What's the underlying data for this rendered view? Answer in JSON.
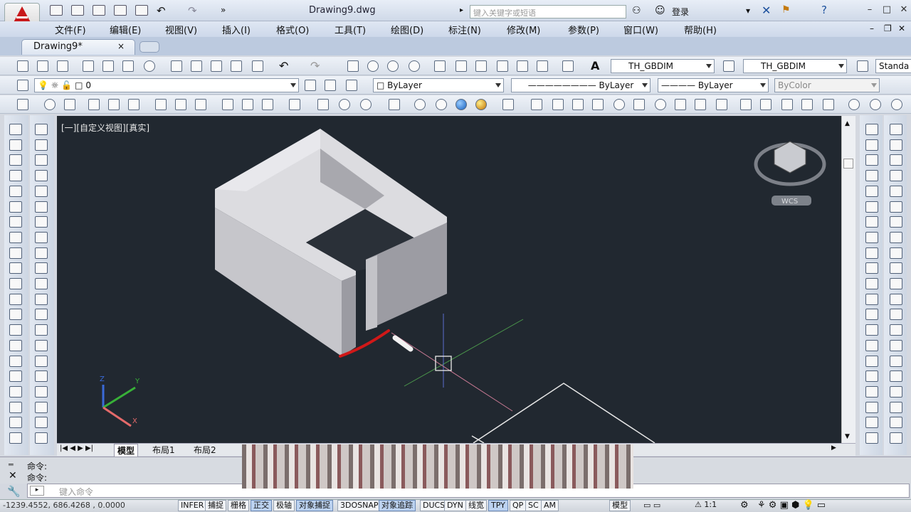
{
  "titlebar": {
    "doc_title": "Drawing9.dwg",
    "search_placeholder": "键入关键字或短语",
    "login": "登录"
  },
  "menu": [
    {
      "label": "文件(F)"
    },
    {
      "label": "编辑(E)"
    },
    {
      "label": "视图(V)"
    },
    {
      "label": "插入(I)"
    },
    {
      "label": "格式(O)"
    },
    {
      "label": "工具(T)"
    },
    {
      "label": "绘图(D)"
    },
    {
      "label": "标注(N)"
    },
    {
      "label": "修改(M)"
    },
    {
      "label": "参数(P)"
    },
    {
      "label": "窗口(W)"
    },
    {
      "label": "帮助(H)"
    }
  ],
  "doc_tab": {
    "label": "Drawing9*",
    "close": "×"
  },
  "styles": {
    "dimstyle1": "TH_GBDIM",
    "dimstyle2": "TH_GBDIM",
    "standard": "Standa"
  },
  "layers": {
    "current_layer": "0",
    "color": "ByLayer",
    "linetype": "ByLayer",
    "lineweight": "ByLayer",
    "plotstyle": "ByColor"
  },
  "viewport": {
    "label": "[一][自定义视图][真实]",
    "wcs": "WCS"
  },
  "layout_tabs": {
    "model": "模型",
    "layout1": "布局1",
    "layout2": "布局2"
  },
  "command": {
    "history1": "命令:",
    "history2": "命令:",
    "placeholder": "键入命令"
  },
  "status": {
    "coords": "-1239.4552, 686.4268 , 0.0000",
    "buttons": [
      "INFER",
      "捕捉",
      "栅格",
      "正交",
      "极轴",
      "对象捕捉",
      "3DOSNAP",
      "对象追踪",
      "DUCS",
      "DYN",
      "线宽",
      "TPY",
      "QP",
      "SC",
      "AM"
    ],
    "on_buttons": [
      "正交",
      "对象捕捉",
      "对象追踪",
      "TPY"
    ],
    "model": "模型",
    "scale": "1:1"
  },
  "colors": {
    "accent_red": "#c8191b",
    "viewport_bg": "#212830",
    "solid_face": "#c9c9cc"
  }
}
